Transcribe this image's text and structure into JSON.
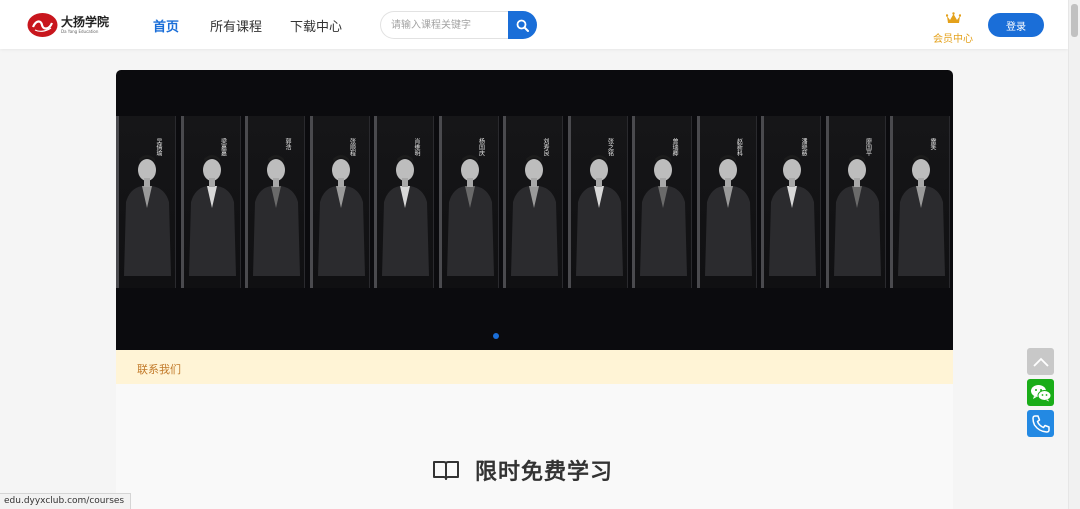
{
  "header": {
    "logo_cn": "大扬学院",
    "logo_en": "Da Yang Education",
    "nav": [
      {
        "label": "首页",
        "active": true
      },
      {
        "label": "所有课程",
        "active": false
      },
      {
        "label": "下载中心",
        "active": false
      }
    ],
    "search_placeholder": "请输入课程关键字",
    "search_icon": "search-icon",
    "vip_label": "会员中心",
    "vip_icon": "crown-icon",
    "login_label": "登录"
  },
  "banner": {
    "people": [
      "吴倩瑜",
      "梁嘉嘉",
      "郭浩",
      "张顺程",
      "肖维明",
      "杨国庆",
      "刘寿良",
      "张之铭",
      "曾瑞卿",
      "赵新科",
      "潘晓慈",
      "廖国平",
      "雷笑"
    ],
    "carousel_active": 1,
    "carousel_total": 1
  },
  "contact": {
    "label": "联系我们"
  },
  "section": {
    "title": "限时免费学习",
    "icon": "book-icon"
  },
  "float_bar": {
    "icons": [
      "back-to-top-icon",
      "wechat-icon",
      "phone-icon"
    ]
  },
  "status_bar": {
    "url": "edu.dyyxclub.com/courses"
  },
  "colors": {
    "brand": "#1a6ed8",
    "vip": "#e4a11b",
    "contact_bg": "#fff4d6",
    "contact_text": "#c27a2a",
    "wechat": "#1aad19",
    "phone": "#2389e3"
  }
}
